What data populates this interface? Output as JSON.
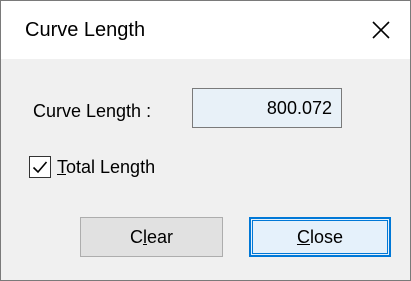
{
  "window": {
    "title": "Curve Length",
    "close_icon": "close-icon"
  },
  "form": {
    "curve_length_label": "Curve Length :",
    "curve_length_value": "800.072",
    "total_length": {
      "checked": true,
      "label_mnemonic": "T",
      "label_rest": "otal Length"
    }
  },
  "buttons": {
    "clear": {
      "mnemonic_pre": "C",
      "mnemonic": "l",
      "rest": "ear"
    },
    "close": {
      "mnemonic": "C",
      "rest": "lose"
    }
  },
  "colors": {
    "title_bg": "#ffffff",
    "client_bg": "#f0f0f0",
    "value_box_bg": "#e8f1f8",
    "default_button_border": "#0078d7",
    "default_button_bg": "#e5f1fb",
    "button_bg": "#e1e1e1"
  }
}
